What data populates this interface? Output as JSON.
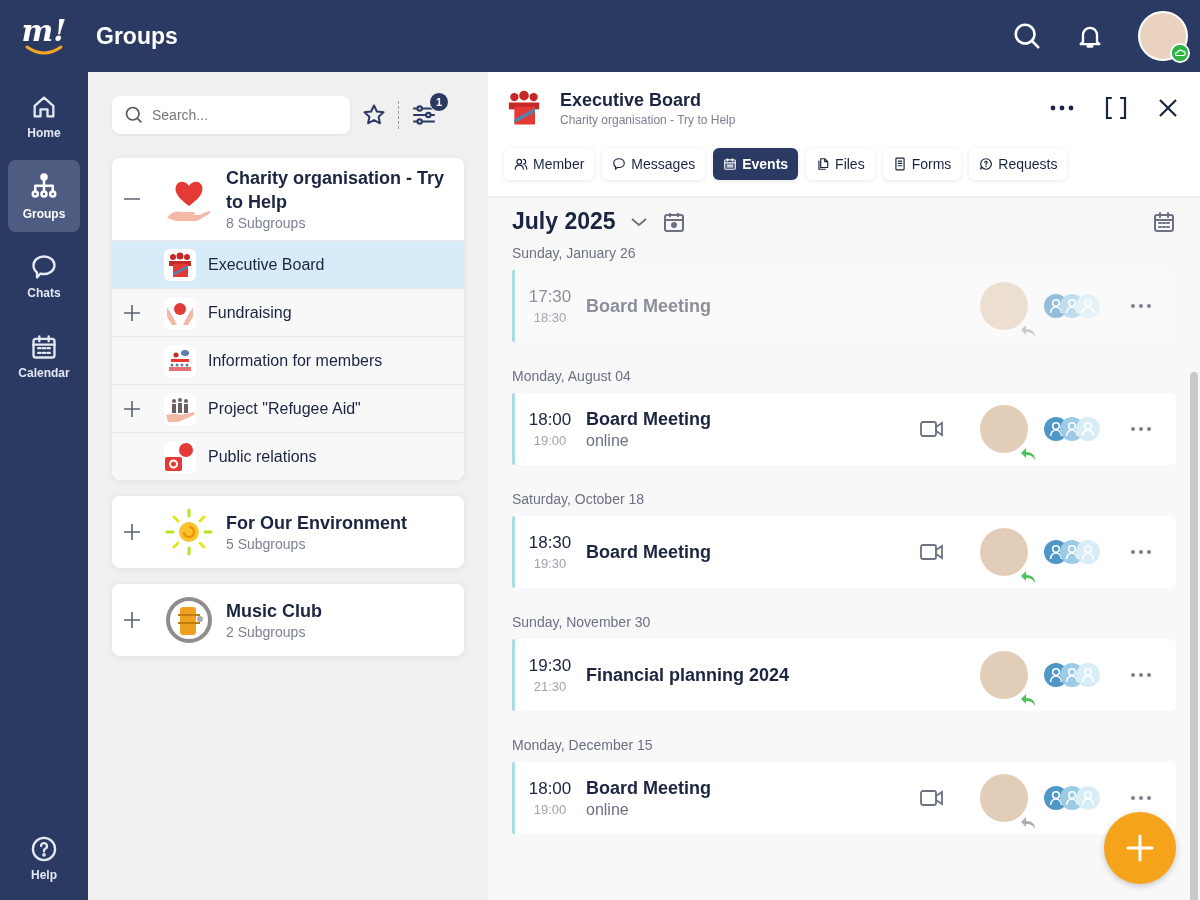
{
  "header": {
    "logo": "m!",
    "title": "Groups"
  },
  "nav": [
    {
      "label": "Home",
      "kind": "home",
      "selected": false
    },
    {
      "label": "Groups",
      "kind": "groups",
      "selected": true
    },
    {
      "label": "Chats",
      "kind": "chats",
      "selected": false
    },
    {
      "label": "Calendar",
      "kind": "calendar",
      "selected": false
    }
  ],
  "nav_bottom": {
    "label": "Help"
  },
  "groups_panel": {
    "search": {
      "placeholder": "Search..."
    },
    "filter_badge": "1",
    "groups": [
      {
        "name": "Charity organisation - Try to Help",
        "subtitle": "8 Subgroups",
        "kind": "heart",
        "expanded": true,
        "children": [
          {
            "name": "Executive Board",
            "kind": "board",
            "expandable": false,
            "selected": true
          },
          {
            "name": "Fundraising",
            "kind": "money",
            "expandable": true,
            "selected": false
          },
          {
            "name": "Information for members",
            "kind": "info",
            "expandable": false,
            "selected": false
          },
          {
            "name": "Project \"Refugee Aid\"",
            "kind": "family",
            "expandable": true,
            "selected": false
          },
          {
            "name": "Public relations",
            "kind": "news",
            "expandable": false,
            "selected": false
          }
        ]
      },
      {
        "name": "For Our Environment",
        "subtitle": "5 Subgroups",
        "kind": "sun",
        "expanded": false
      },
      {
        "name": "Music Club",
        "subtitle": "2 Subgroups",
        "kind": "music",
        "expanded": false
      }
    ]
  },
  "detail": {
    "title": "Executive Board",
    "subtitle": "Charity organisation - Try to Help",
    "tabs": [
      {
        "label": "Member",
        "kind": "member",
        "selected": false
      },
      {
        "label": "Messages",
        "kind": "messages",
        "selected": false
      },
      {
        "label": "Events",
        "kind": "events",
        "selected": true
      },
      {
        "label": "Files",
        "kind": "files",
        "selected": false
      },
      {
        "label": "Forms",
        "kind": "forms",
        "selected": false
      },
      {
        "label": "Requests",
        "kind": "requests",
        "selected": false
      }
    ],
    "month": "July 2025",
    "days": [
      {
        "date": "Sunday, January 26",
        "events": [
          {
            "start": "17:30",
            "end": "18:30",
            "title": "Board Meeting",
            "past": true,
            "video": false,
            "replied": false
          }
        ]
      },
      {
        "date": "Monday, August 04",
        "events": [
          {
            "start": "18:00",
            "end": "19:00",
            "title": "Board Meeting",
            "location": "online",
            "past": false,
            "video": true,
            "replied": true
          }
        ]
      },
      {
        "date": "Saturday, October 18",
        "events": [
          {
            "start": "18:30",
            "end": "19:30",
            "title": "Board Meeting",
            "past": false,
            "video": true,
            "replied": true
          }
        ]
      },
      {
        "date": "Sunday, November 30",
        "events": [
          {
            "start": "19:30",
            "end": "21:30",
            "title": "Financial planning 2024",
            "past": false,
            "video": false,
            "replied": true
          }
        ]
      },
      {
        "date": "Monday, December 15",
        "events": [
          {
            "start": "18:00",
            "end": "19:00",
            "title": "Board Meeting",
            "location": "online",
            "past": false,
            "video": true,
            "replied": false
          }
        ]
      }
    ]
  }
}
